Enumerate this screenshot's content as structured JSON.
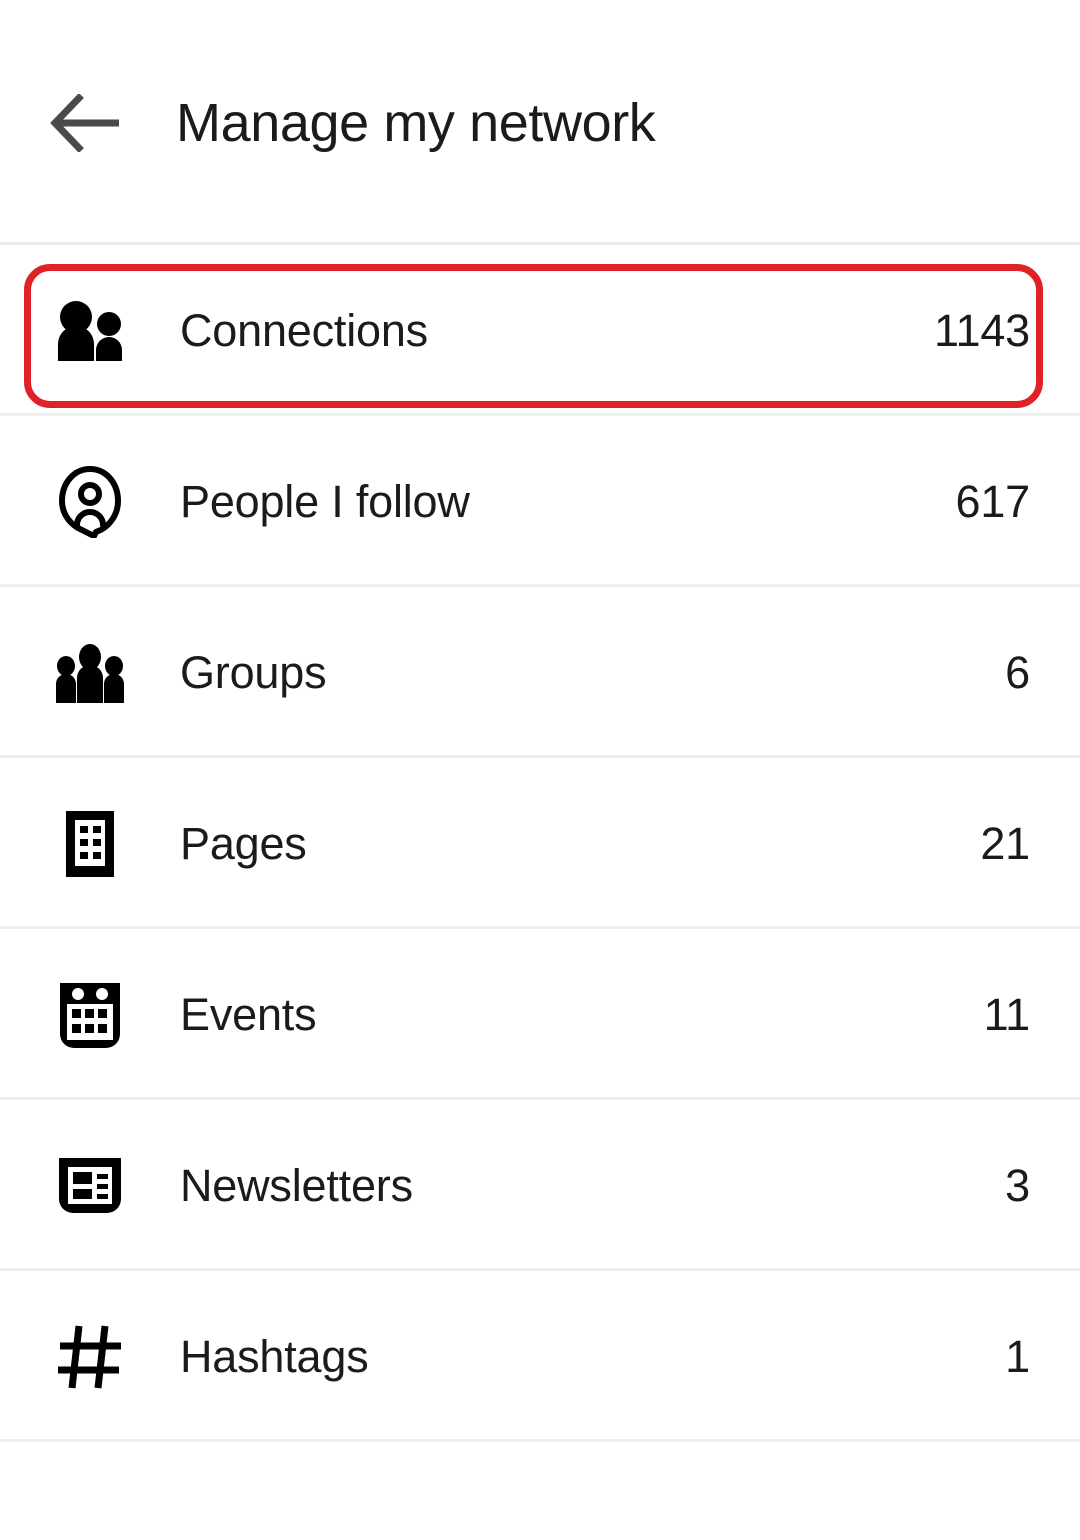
{
  "header": {
    "title": "Manage my network",
    "back_icon": "arrow-left-icon"
  },
  "highlight": {
    "color": "#e02127",
    "target": "Connections"
  },
  "colors": {
    "accent_red": "#e02127",
    "text": "#1b1b1b",
    "separator": "#ededed",
    "back_arrow": "#4a4a4a",
    "background": "#ffffff"
  },
  "list": {
    "items": [
      {
        "label": "Connections",
        "count": "1143",
        "icon": "people-pair-icon",
        "highlighted": true
      },
      {
        "label": "People I follow",
        "count": "617",
        "icon": "follow-bubble-icon",
        "highlighted": false
      },
      {
        "label": "Groups",
        "count": "6",
        "icon": "people-group-icon",
        "highlighted": false
      },
      {
        "label": "Pages",
        "count": "21",
        "icon": "building-icon",
        "highlighted": false
      },
      {
        "label": "Events",
        "count": "11",
        "icon": "calendar-icon",
        "highlighted": false
      },
      {
        "label": "Newsletters",
        "count": "3",
        "icon": "newsletter-icon",
        "highlighted": false
      },
      {
        "label": "Hashtags",
        "count": "1",
        "icon": "hashtag-icon",
        "highlighted": false
      }
    ]
  }
}
